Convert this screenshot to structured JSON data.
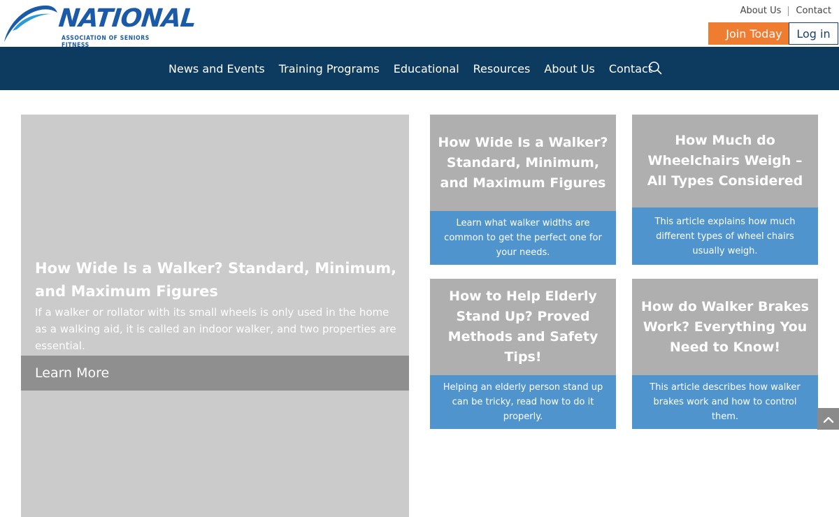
{
  "brand": {
    "name": "NATIONAL",
    "subtitle": "ASSOCIATION OF SENIORS FITNESS",
    "color": "#1a5aa6"
  },
  "top_links": [
    "About Us",
    "Contact"
  ],
  "buttons": {
    "join": "Join Today",
    "login": "Log in",
    "join_color": "#ee7c31"
  },
  "nav": {
    "items": [
      "News and Events",
      "Training Programs",
      "Educational",
      "Resources",
      "About Us",
      "Contact"
    ],
    "search_icon": "search-icon",
    "background": "#0d3a5f"
  },
  "hero": {
    "title": "How Wide Is a Walker? Standard, Minimum, and Maximum Figures",
    "description": "If a walker or rollator with its small wheels is only used in the home as a walking aid, it is called an indoor walker, and two properties are essential.",
    "cta": "Learn More"
  },
  "cards": [
    {
      "title": "How Wide Is a Walker? Standard, Minimum, and Maximum Figures",
      "description": "Learn what walker widths are common to get the perfect one for your needs."
    },
    {
      "title": "How Much do Wheelchairs Weigh – All Types Considered",
      "description": "This article explains how much different types of wheel chairs usually weigh."
    },
    {
      "title": "How to Help Elderly Stand Up? Proved Methods and Safety Tips!",
      "description": "Helping an elderly person stand up can be tricky, read how to do it properly."
    },
    {
      "title": "How do Walker Brakes Work? Everything You Need to Know!",
      "description": "This article describes how walker brakes work and how to control them."
    }
  ],
  "scroll_top_icon": "chevron-up-icon",
  "colors": {
    "card_top": "#afafaf",
    "card_bottom": "#4f94cd",
    "hero_bg": "#cbcbcb"
  }
}
